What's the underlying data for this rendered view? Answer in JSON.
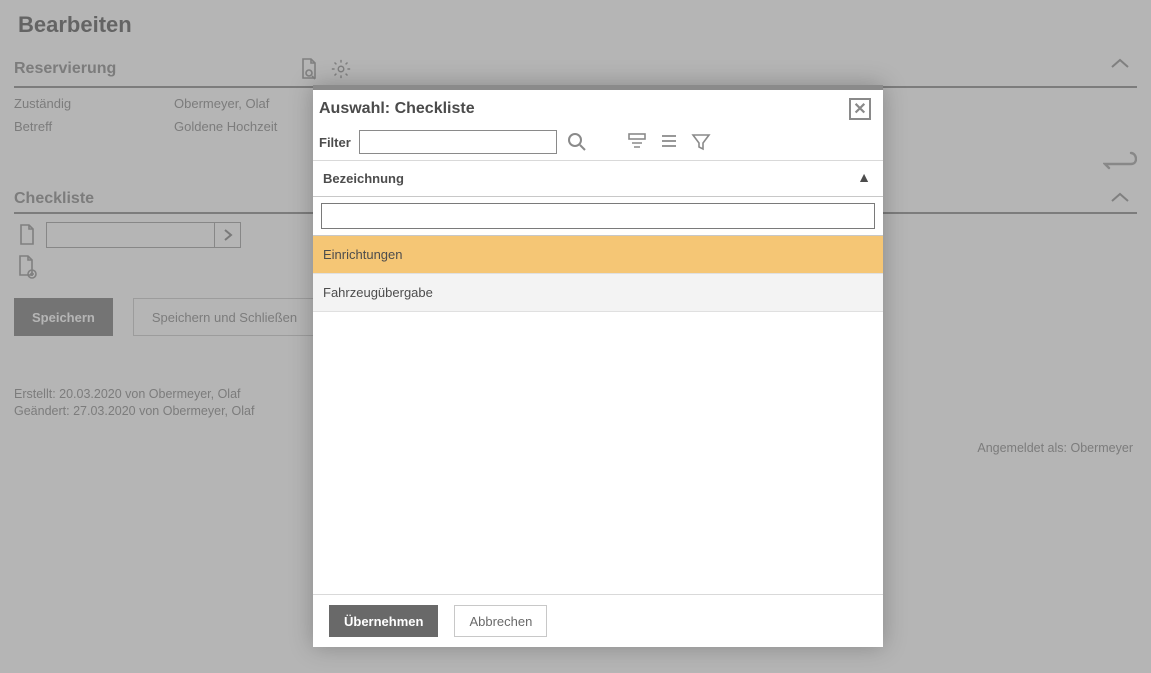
{
  "page": {
    "title": "Bearbeiten",
    "reservation": {
      "section_title": "Reservierung",
      "fields": {
        "responsible_label": "Zuständig",
        "responsible_value": "Obermeyer, Olaf",
        "subject_label": "Betreff",
        "subject_value": "Goldene Hochzeit"
      }
    },
    "checklist": {
      "section_title": "Checkliste"
    },
    "buttons": {
      "save": "Speichern",
      "save_close": "Speichern und Schließen"
    },
    "footer": {
      "created": "Erstellt:  20.03.2020 von Obermeyer, Olaf",
      "changed": "Geändert: 27.03.2020 von Obermeyer, Olaf",
      "logged_in": "Angemeldet als: Obermeyer"
    }
  },
  "modal": {
    "title": "Auswahl: Checkliste",
    "filter_label": "Filter",
    "filter_value": "",
    "column_header": "Bezeichnung",
    "search_value": "",
    "items": [
      {
        "label": "Einrichtungen",
        "selected": true
      },
      {
        "label": "Fahrzeugübergabe",
        "selected": false
      }
    ],
    "buttons": {
      "ok": "Übernehmen",
      "cancel": "Abbrechen"
    }
  }
}
